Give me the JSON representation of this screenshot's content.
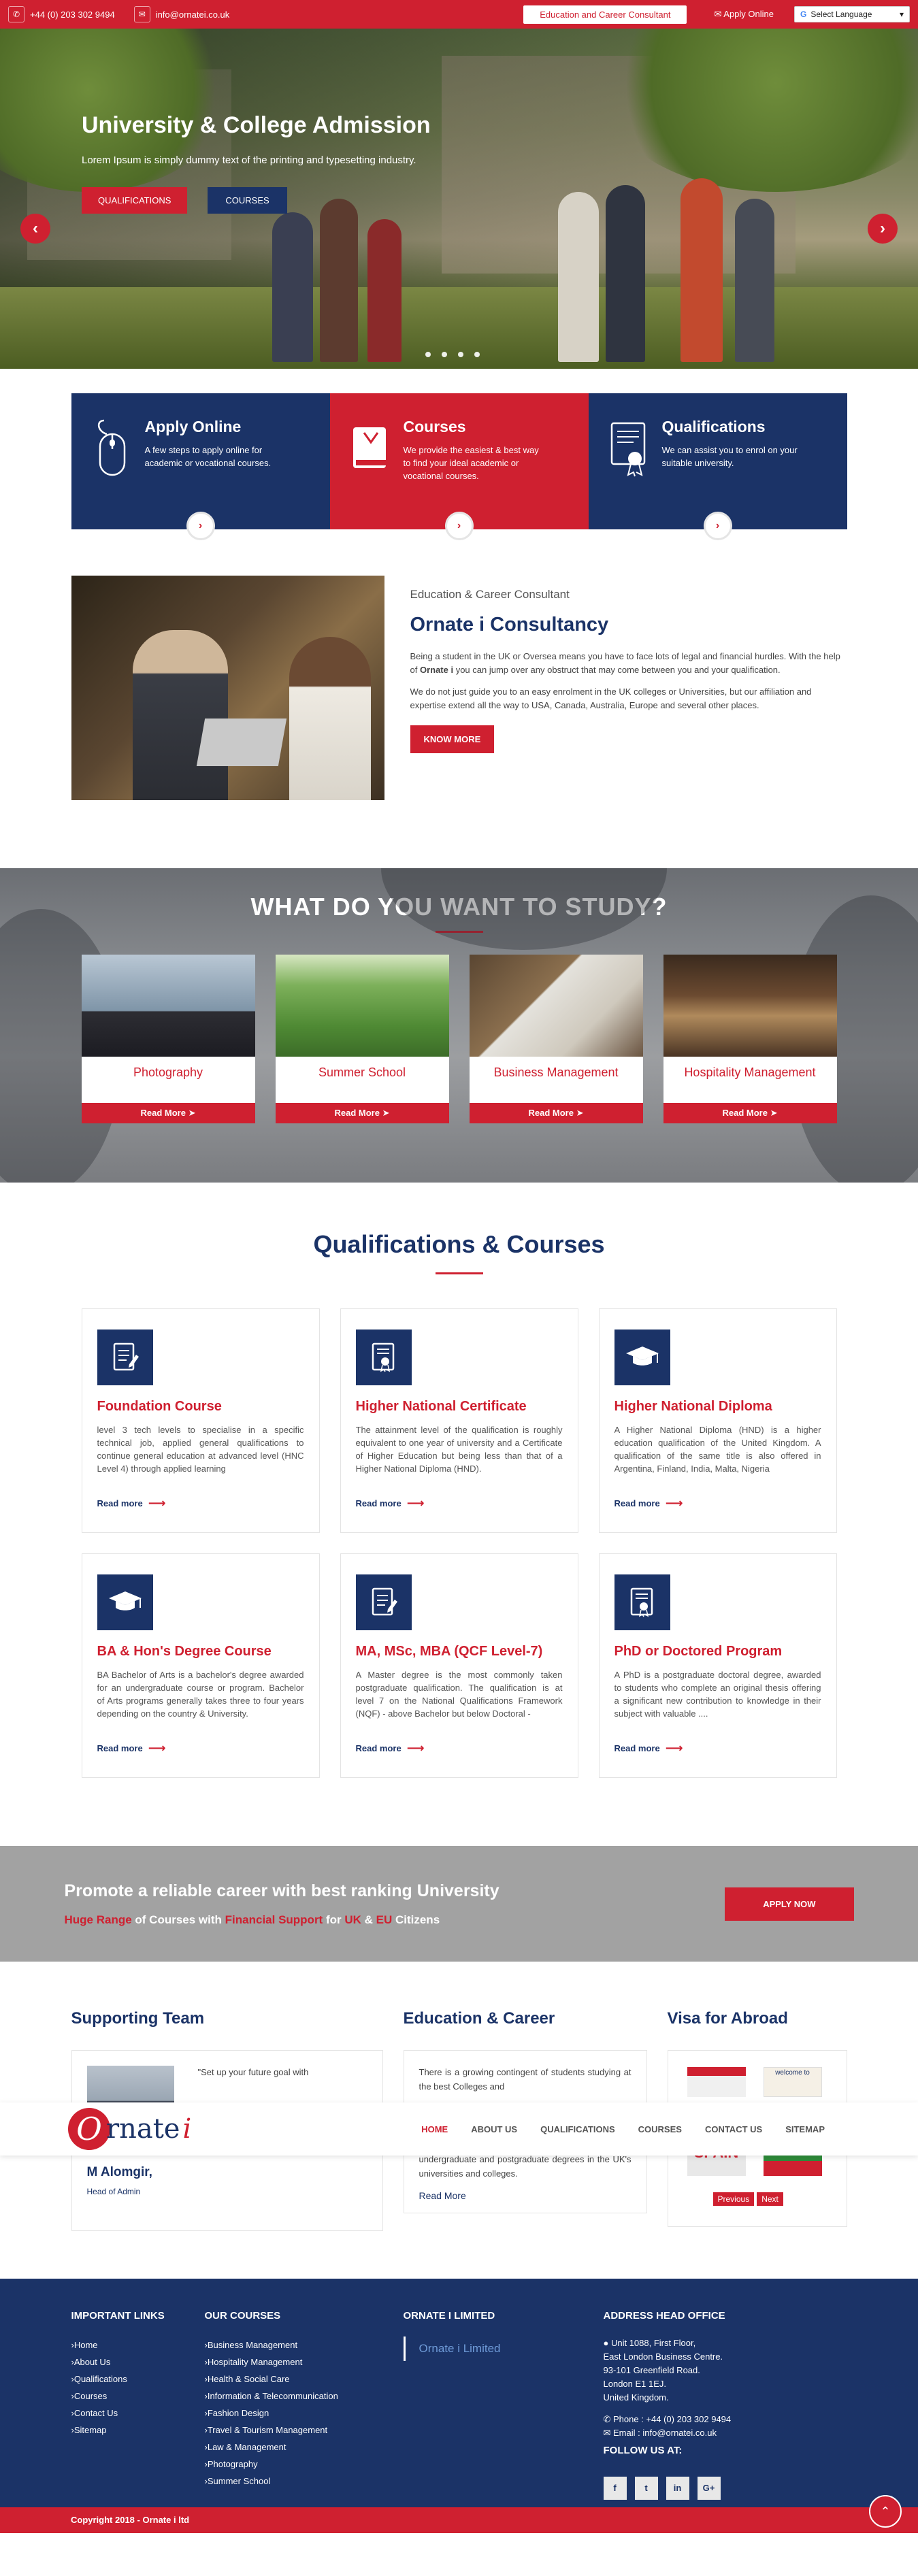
{
  "topbar": {
    "phone": "+44 (0) 203 302 9494",
    "email": "info@ornatei.co.uk",
    "badge": "Education and Career Consultant",
    "apply": "Apply Online",
    "language": "Select Language"
  },
  "hero": {
    "title": "University & College Admission",
    "subtitle": "Lorem Ipsum is simply dummy text of the printing and typesetting industry.",
    "btn_primary": "QUALIFICATIONS",
    "btn_secondary": "COURSES",
    "prev": "‹",
    "next": "›"
  },
  "features": [
    {
      "title": "Apply Online",
      "text": "A few steps to apply online for academic or vocational courses.",
      "icon": "mouse-icon"
    },
    {
      "title": "Courses",
      "text": "We provide the easiest & best way to find your ideal academic or vocational courses.",
      "icon": "book-icon"
    },
    {
      "title": "Qualifications",
      "text": "We can assist you to enrol on your suitable university.",
      "icon": "certificate-icon"
    }
  ],
  "about": {
    "kicker": "Education & Career Consultant",
    "title": "Ornate i Consultancy",
    "p1_a": "Being a student in the UK or Oversea means you have to face lots of legal and financial hurdles. With the help of ",
    "p1_b": "Ornate i",
    "p1_c": " you can jump over any obstruct that may come between you and your qualification.",
    "p2": "We do not just guide you to an easy enrolment in the UK colleges or Universities, but our affiliation and expertise extend all the way to USA, Canada, Australia, Europe and several other places.",
    "btn": "KNOW MORE"
  },
  "study": {
    "title": "WHAT DO YOU WANT TO STUDY?",
    "read_more": "Read More",
    "items": [
      "Photography",
      "Summer School",
      "Business Management",
      "Hospitality Management"
    ]
  },
  "quals": {
    "title": "Qualifications & Courses",
    "read_more": "Read more",
    "items": [
      {
        "title": "Foundation Course",
        "text": "level 3 tech levels to specialise in a specific technical job, applied general qualifications to continue general education at advanced level (HNC Level 4) through applied learning",
        "icon": "document-icon"
      },
      {
        "title": "Higher National Certificate",
        "text": "The attainment level of the qualification is roughly equivalent to one year of university and a Certificate of Higher Education but being less than that of a Higher National Diploma (HND).",
        "icon": "certificate-icon"
      },
      {
        "title": "Higher National Diploma",
        "text": "A Higher National Diploma (HND) is a higher education qualification of the United Kingdom. A qualification of the same title is also offered in Argentina, Finland, India, Malta, Nigeria",
        "icon": "graduation-cap-icon"
      },
      {
        "title": "BA & Hon's Degree Course",
        "text": "BA Bachelor of Arts is a bachelor's degree awarded for an undergraduate course or program. Bachelor of Arts programs generally takes three to four years depending on the country & University.",
        "icon": "graduation-cap-icon"
      },
      {
        "title": "MA, MSc, MBA (QCF Level-7)",
        "text": "A Master degree is the most commonly taken postgraduate qualification. The qualification is at level 7 on the National Qualifications Framework (NQF) - above Bachelor but below Doctoral -",
        "icon": "document-icon"
      },
      {
        "title": "PhD or Doctored Program",
        "text": "A PhD is a postgraduate doctoral degree, awarded to students who complete an original thesis offering a significant new contribution to knowledge in their subject with valuable ....",
        "icon": "certificate-icon"
      }
    ]
  },
  "promo": {
    "title": "Promote a reliable career with best ranking University",
    "l1": "Huge Range",
    "l2": " of Courses with ",
    "l3": "Financial Support",
    "l4": " for ",
    "l5": "UK",
    "l6": " & ",
    "l7": "EU",
    "l8": " Citizens",
    "btn": "APPLY NOW"
  },
  "team": {
    "title": "Supporting Team",
    "quote": "\"Set up your future goal with",
    "name": "M Alomgir,",
    "role": "Head of Admin"
  },
  "edu": {
    "title": "Education & Career",
    "text_top": "There is a growing contingent of students studying at the best Colleges and",
    "text_bottom": "regarded around the world. Search 1000 undergraduate and postgraduate degrees in the UK's universities and colleges.",
    "more": "Read More"
  },
  "visa": {
    "title": "Visa for Abroad",
    "img_text1": "welcome to",
    "img_text2": "SPAIN",
    "prev": "Previous",
    "next": "Next"
  },
  "nav": {
    "logo_o": "O",
    "logo_text": "rnate",
    "logo_i": "i",
    "links": [
      "HOME",
      "ABOUT US",
      "QUALIFICATIONS",
      "COURSES",
      "CONTACT US",
      "SITEMAP"
    ]
  },
  "footer": {
    "h1": "IMPORTANT LINKS",
    "links": [
      "Home",
      "About Us",
      "Qualifications",
      "Courses",
      "Contact Us",
      "Sitemap"
    ],
    "h2": "OUR COURSES",
    "courses": [
      "Business Management",
      "Hospitality Management",
      "Health & Social Care",
      "Information & Telecommunication",
      "Fashion Design",
      "Travel & Tourism Management",
      "Law & Management",
      "Photography",
      "Summer School"
    ],
    "h3": "ORNATE I LIMITED",
    "brand": "Ornate i Limited",
    "h4": "ADDRESS HEAD OFFICE",
    "addr": [
      "Unit 1088, First Floor,",
      "East London Business Centre.",
      "93-101 Greenfield Road.",
      "London E1 1EJ.",
      "United Kingdom."
    ],
    "phone": "Phone : +44 (0) 203 302 9494",
    "email": "Email : info@ornatei.co.uk",
    "follow": "FOLLOW US AT:",
    "socials": [
      "f",
      "t",
      "in",
      "G+"
    ],
    "copyright": "Copyright 2018 - Ornate i ltd"
  }
}
